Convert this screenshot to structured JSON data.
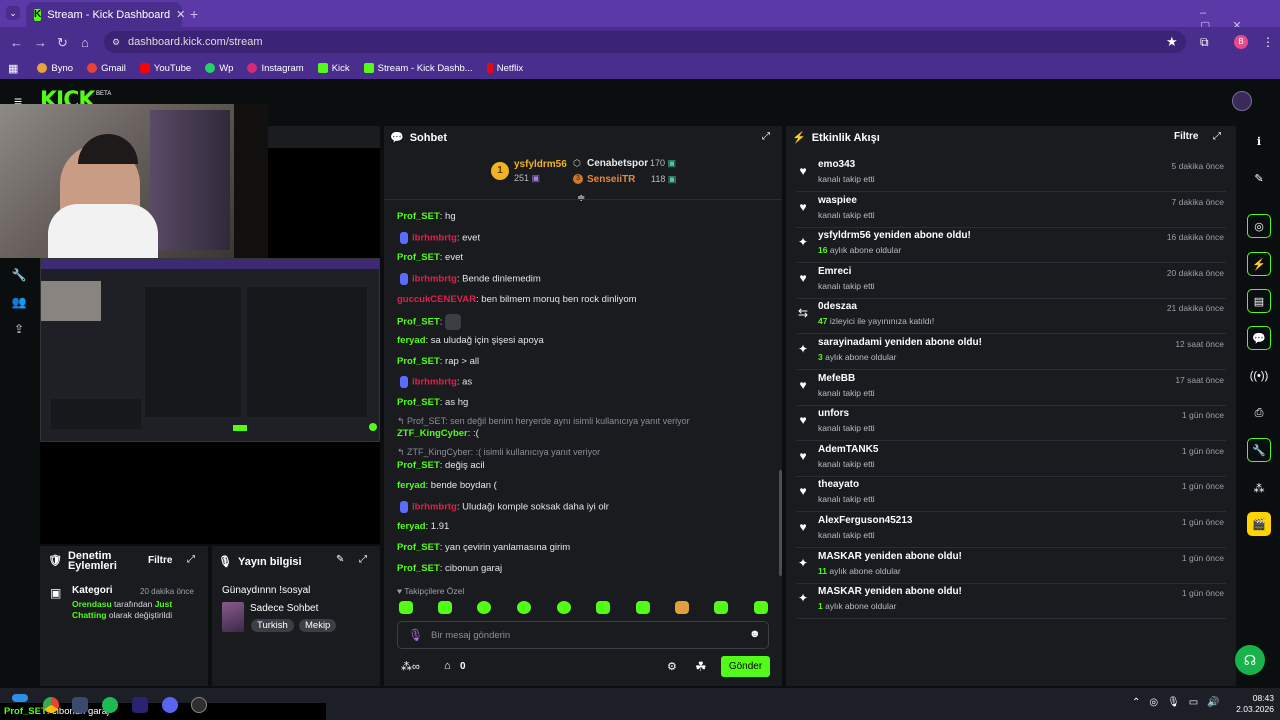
{
  "browser": {
    "tab_title": "Stream - Kick Dashboard",
    "url": "dashboard.kick.com/stream",
    "profile_initial": "B",
    "bookmarks": [
      "Byno",
      "Gmail",
      "YouTube",
      "Wp",
      "Instagram",
      "Kick",
      "Stream - Kick Dashb...",
      "Netflix"
    ]
  },
  "app": {
    "logo": "KICK",
    "beta": "BETA"
  },
  "chat": {
    "title": "Sohbet",
    "top_supporters": [
      {
        "rank": "1",
        "name": "ysfyldrm56",
        "count": "251"
      },
      {
        "rank": "",
        "name": "Cenabetspor",
        "count": "170"
      },
      {
        "rank": "3",
        "name": "SenseiiTR",
        "count": "118"
      }
    ],
    "messages": [
      {
        "user": "Prof_SET",
        "text": ": hg"
      },
      {
        "user": "ibrhmbrtg",
        "text": ": evet"
      },
      {
        "user": "Prof_SET",
        "text": ": evet"
      },
      {
        "user": "ibrhmbrtg",
        "text": ": Bende dinlemedim"
      },
      {
        "user": "guccukCENEVAR",
        "text": ": ben bilmem moruq ben rock dinliyom"
      },
      {
        "user": "Prof_SET",
        "text": ":"
      },
      {
        "user": "feryad",
        "text": ": sa uludağ için şişesi apoya"
      },
      {
        "user": "Prof_SET",
        "text": ": rap > all"
      },
      {
        "user": "ibrhmbrtg",
        "text": ": as"
      },
      {
        "user": "Prof_SET",
        "text": ": as hg"
      },
      {
        "reply": "Prof_SET: sen değil benim heryerde aynı isimli kullanıcıya yanıt veriyor",
        "user": "ZTF_KingCyber",
        "text": ": :("
      },
      {
        "reply": "ZTF_KingCyber: :( isimli kullanıcıya yanıt veriyor",
        "user": "Prof_SET",
        "text": ": değiş acil"
      },
      {
        "user": "feryad",
        "text": ": bende boydan ("
      },
      {
        "user": "ibrhmbrtg",
        "text": ": Uludağı komple soksak daha iyi olr"
      },
      {
        "user": "feryad",
        "text": ": 1.91"
      },
      {
        "user": "Prof_SET",
        "text": ": yan çevirin yanlamasına girim"
      },
      {
        "user": "Prof_SET",
        "text": ": cibonun garaj"
      }
    ],
    "emote_filter": "Takipçilere Özel",
    "input_placeholder": "Bir mesaj gönderin",
    "points": "0",
    "send_label": "Gönder"
  },
  "events": {
    "title": "Etkinlik Akışı",
    "filter_label": "Filtre",
    "items": [
      {
        "icon": "heart-icon",
        "name": "emo343",
        "sub": "kanalı takip etti",
        "time": "5 dakika önce",
        "hl": ""
      },
      {
        "icon": "heart-icon",
        "name": "waspiee",
        "sub": "kanalı takip etti",
        "time": "7 dakika önce",
        "hl": ""
      },
      {
        "icon": "sparkle-icon",
        "name": "ysfyldrm56 yeniden abone oldu!",
        "hl": "16",
        "sub": " aylık abone oldular",
        "time": "16 dakika önce"
      },
      {
        "icon": "heart-icon",
        "name": "Emreci",
        "sub": "kanalı takip etti",
        "time": "20 dakika önce",
        "hl": ""
      },
      {
        "icon": "host-icon",
        "name": "0deszaa",
        "hl": "47",
        "sub": " izleyici ile yayınınıza katıldı!",
        "time": "21 dakika önce"
      },
      {
        "icon": "sparkle-icon",
        "name": "sarayinadami yeniden abone oldu!",
        "hl": "3",
        "sub": " aylık abone oldular",
        "time": "12 saat önce"
      },
      {
        "icon": "heart-icon",
        "name": "MefeBB",
        "sub": "kanalı takip etti",
        "time": "17 saat önce",
        "hl": ""
      },
      {
        "icon": "heart-icon",
        "name": "unfors",
        "sub": "kanalı takip etti",
        "time": "1 gün önce",
        "hl": ""
      },
      {
        "icon": "heart-icon",
        "name": "AdemTANK5",
        "sub": "kanalı takip etti",
        "time": "1 gün önce",
        "hl": ""
      },
      {
        "icon": "heart-icon",
        "name": "theayato",
        "sub": "kanalı takip etti",
        "time": "1 gün önce",
        "hl": ""
      },
      {
        "icon": "heart-icon",
        "name": "AlexFerguson45213",
        "sub": "kanalı takip etti",
        "time": "1 gün önce",
        "hl": ""
      },
      {
        "icon": "sparkle-icon",
        "name": "MASKAR yeniden abone oldu!",
        "hl": "11",
        "sub": " aylık abone oldular",
        "time": "1 gün önce"
      },
      {
        "icon": "sparkle-icon",
        "name": "MASKAR yeniden abone oldu!",
        "hl": "1",
        "sub": " aylık abone oldular",
        "time": "1 gün önce"
      }
    ]
  },
  "mod_panel": {
    "title": "Denetim Eylemleri",
    "filter_label": "Filtre",
    "item_title": "Kategori",
    "item_time": "20 dakika önce",
    "actor": "Orendasu",
    "mid_text": " tarafından ",
    "category": "Just Chatting",
    "end_text": " olarak değiştirildi"
  },
  "stream_info": {
    "title": "Yayın bilgisi",
    "stream_title": "Günaydınnn !sosyal",
    "category": "Sadece Sohbet",
    "tags": [
      "Turkish",
      "Mekip"
    ]
  },
  "taskbar": {
    "overlay_user": "Prof_SET",
    "overlay_text": ": cibonun garaj",
    "time": "08:43",
    "date": "2.03.2026"
  }
}
